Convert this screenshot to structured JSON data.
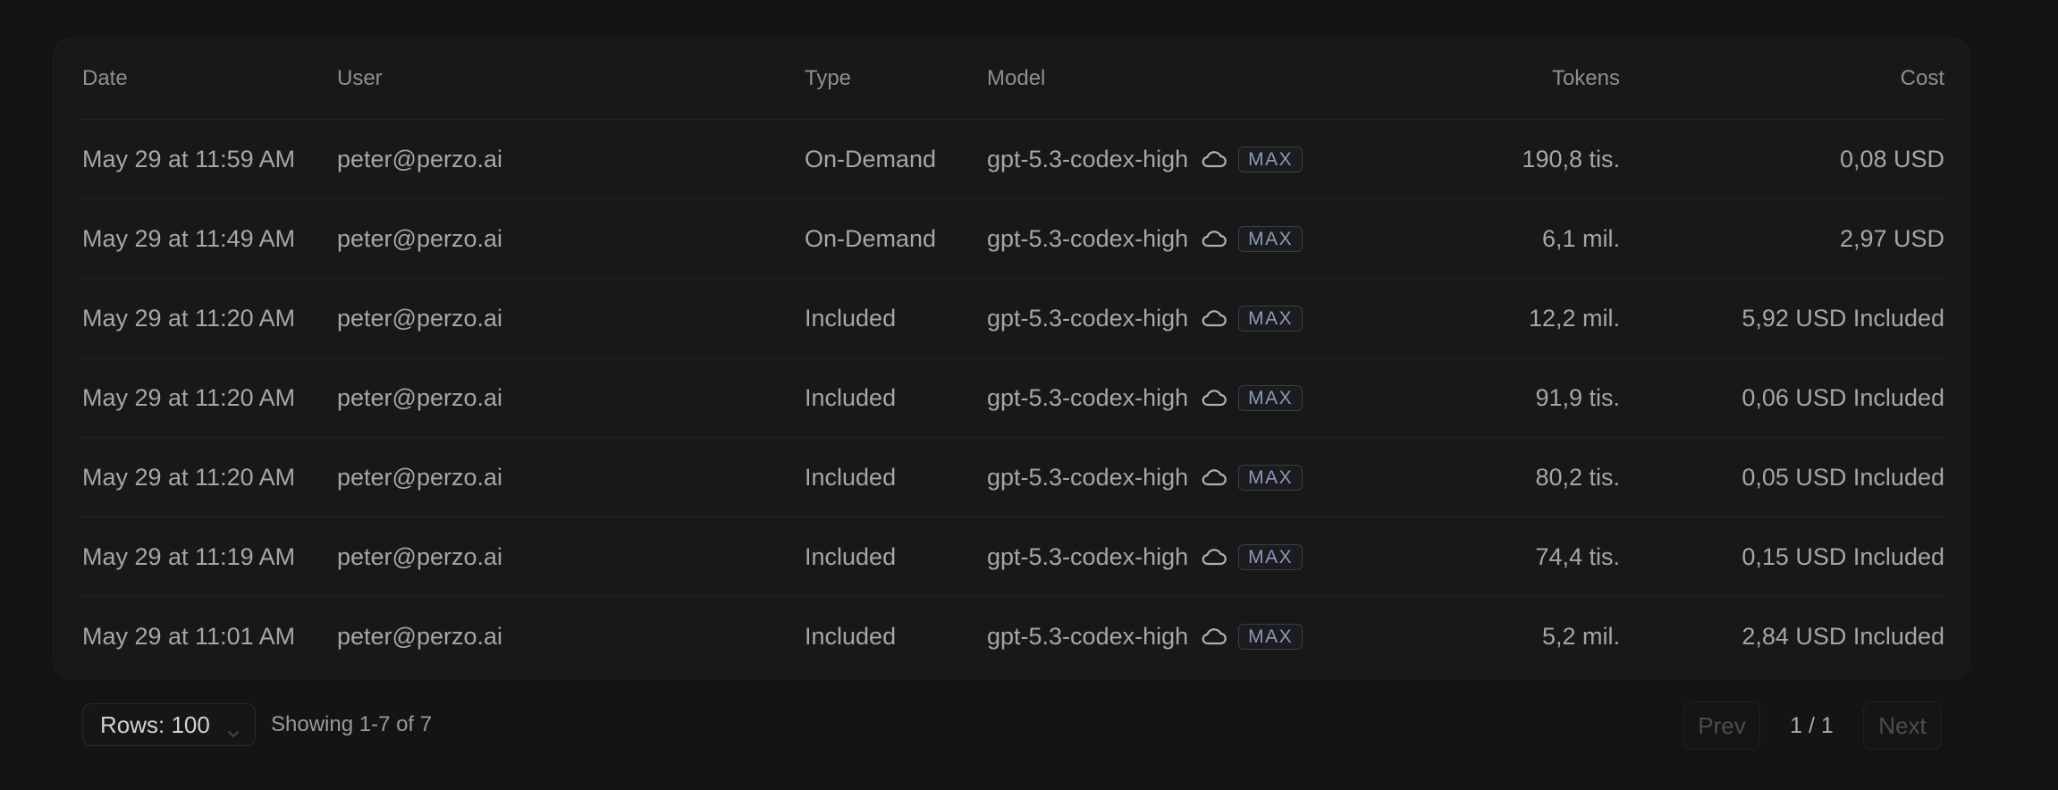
{
  "table": {
    "headers": {
      "date": "Date",
      "user": "User",
      "type": "Type",
      "model": "Model",
      "tokens": "Tokens",
      "cost": "Cost"
    },
    "rows": [
      {
        "date": "May 29 at 11:59 AM",
        "user": "peter@perzo.ai",
        "type": "On-Demand",
        "model": "gpt-5.3-codex-high",
        "badge": "MAX",
        "tokens": "190,8 tis.",
        "cost": "0,08 USD"
      },
      {
        "date": "May 29 at 11:49 AM",
        "user": "peter@perzo.ai",
        "type": "On-Demand",
        "model": "gpt-5.3-codex-high",
        "badge": "MAX",
        "tokens": "6,1 mil.",
        "cost": "2,97 USD"
      },
      {
        "date": "May 29 at 11:20 AM",
        "user": "peter@perzo.ai",
        "type": "Included",
        "model": "gpt-5.3-codex-high",
        "badge": "MAX",
        "tokens": "12,2 mil.",
        "cost": "5,92 USD Included"
      },
      {
        "date": "May 29 at 11:20 AM",
        "user": "peter@perzo.ai",
        "type": "Included",
        "model": "gpt-5.3-codex-high",
        "badge": "MAX",
        "tokens": "91,9 tis.",
        "cost": "0,06 USD Included"
      },
      {
        "date": "May 29 at 11:20 AM",
        "user": "peter@perzo.ai",
        "type": "Included",
        "model": "gpt-5.3-codex-high",
        "badge": "MAX",
        "tokens": "80,2 tis.",
        "cost": "0,05 USD Included"
      },
      {
        "date": "May 29 at 11:19 AM",
        "user": "peter@perzo.ai",
        "type": "Included",
        "model": "gpt-5.3-codex-high",
        "badge": "MAX",
        "tokens": "74,4 tis.",
        "cost": "0,15 USD Included"
      },
      {
        "date": "May 29 at 11:01 AM",
        "user": "peter@perzo.ai",
        "type": "Included",
        "model": "gpt-5.3-codex-high",
        "badge": "MAX",
        "tokens": "5,2 mil.",
        "cost": "2,84 USD Included"
      }
    ]
  },
  "footer": {
    "rows_select": "Rows: 100",
    "showing": "Showing 1-7 of 7",
    "prev": "Prev",
    "page": "1 / 1",
    "next": "Next"
  },
  "icons": {
    "cloud": "cloud-icon",
    "chevron": "chevron-down-icon"
  },
  "colors": {
    "background": "#141414",
    "card": "#181818",
    "badge_text": "#8e9ab4"
  }
}
